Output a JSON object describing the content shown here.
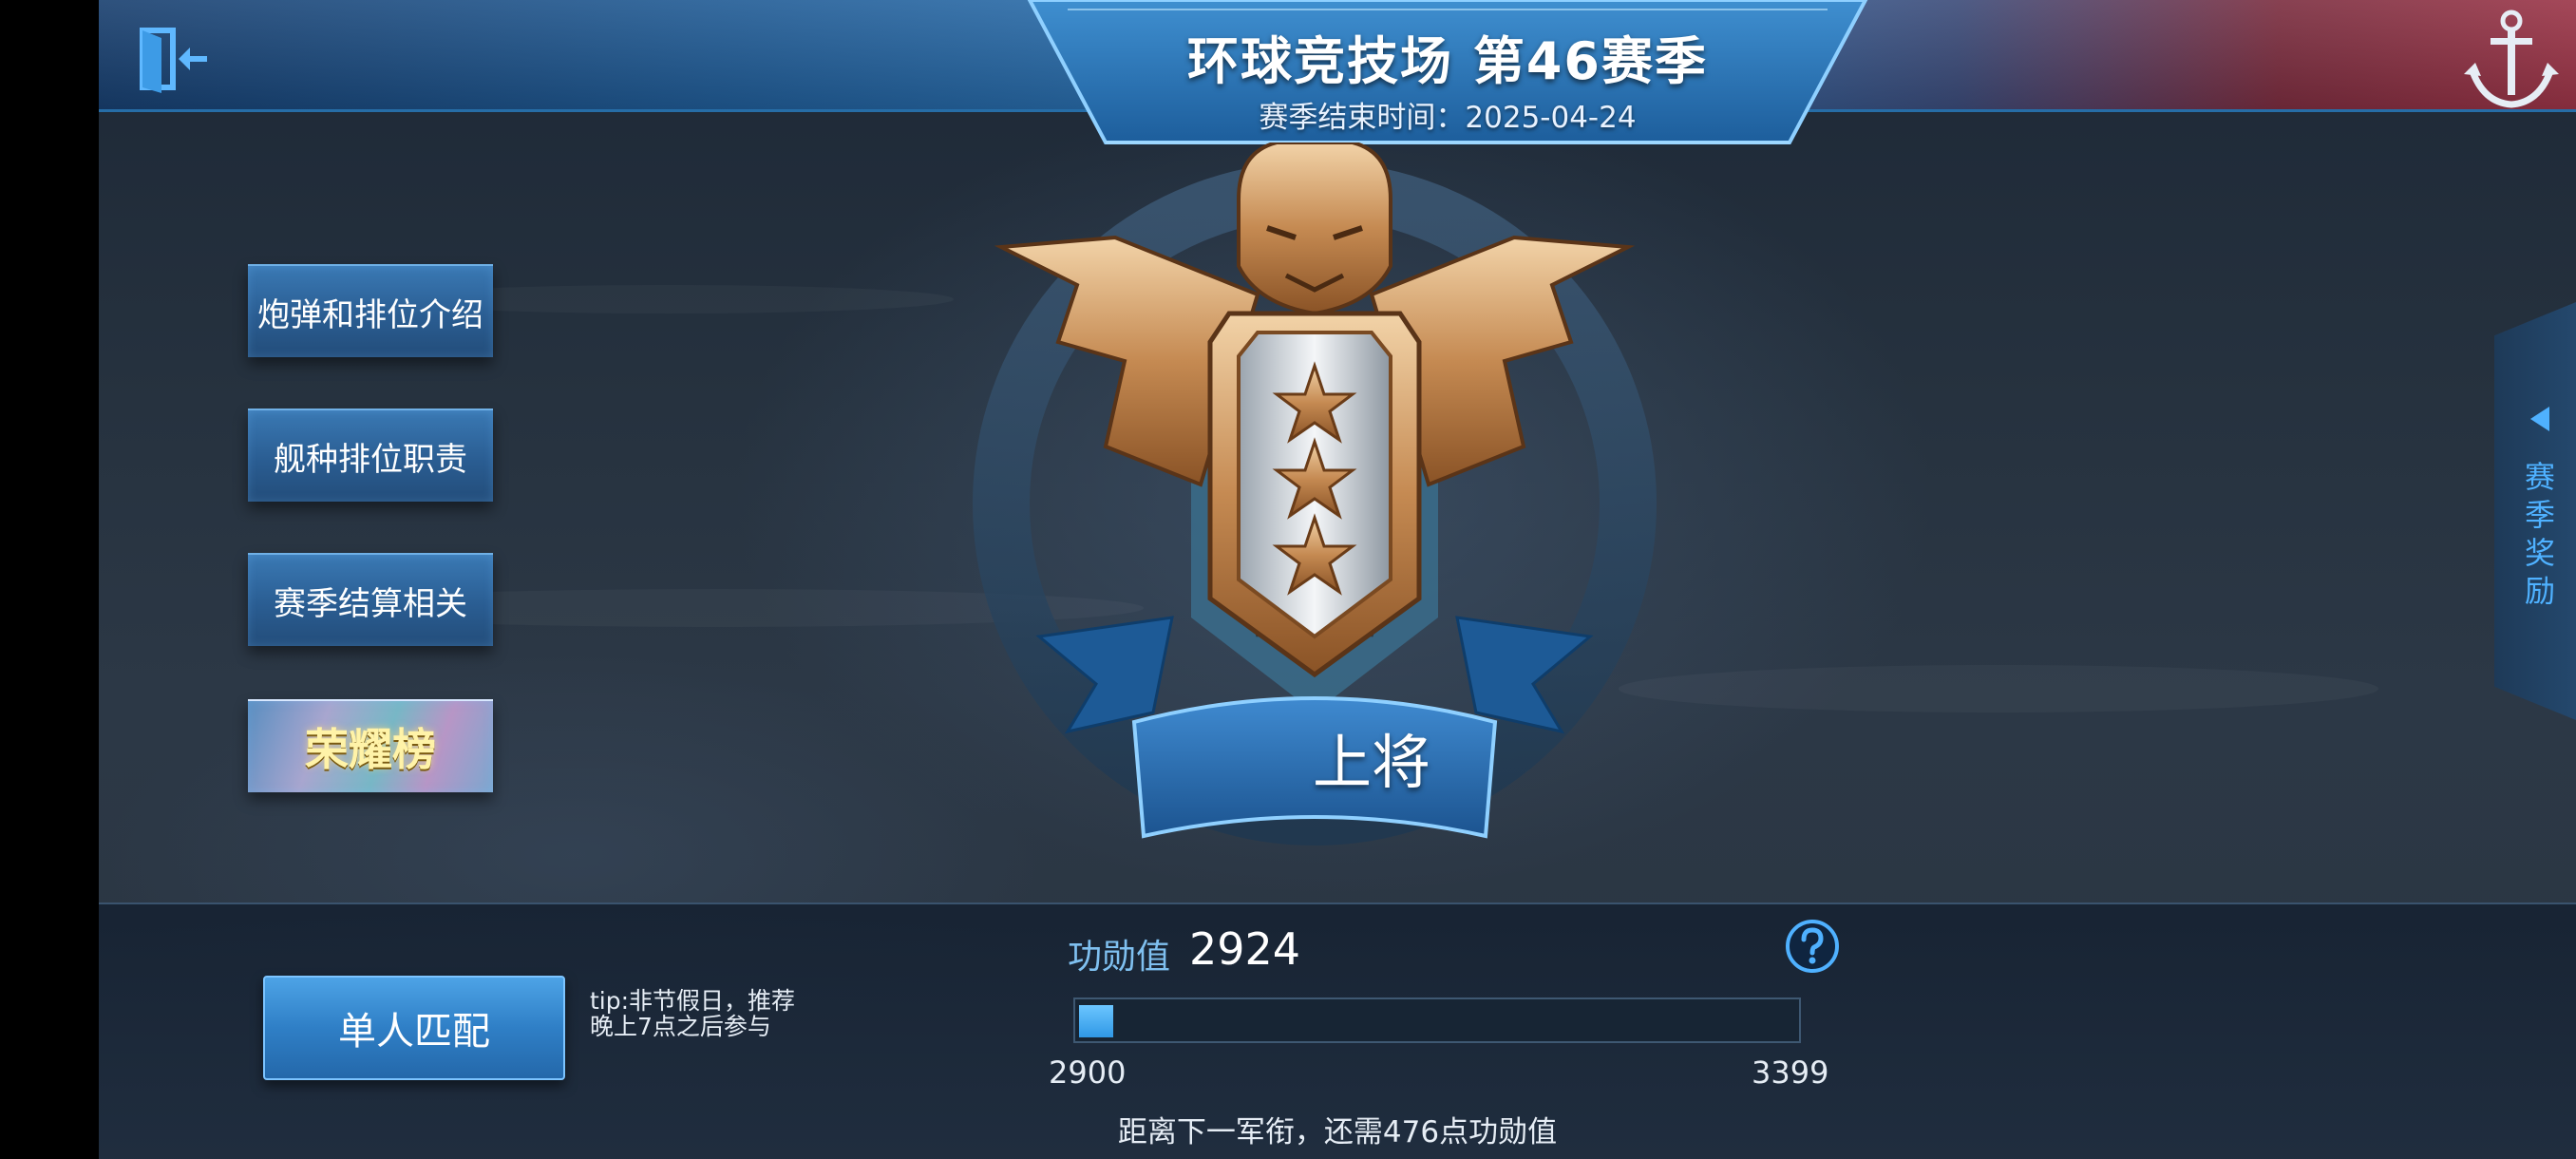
{
  "header": {
    "title": "环球竞技场  第46赛季",
    "season_end": "赛季结束时间：2025-04-24"
  },
  "menu": {
    "items": [
      {
        "label": "炮弹和排位介绍"
      },
      {
        "label": "舰种排位职责"
      },
      {
        "label": "赛季结算相关"
      },
      {
        "label": "荣耀榜"
      }
    ]
  },
  "rank": {
    "name": "上将",
    "stars": 3
  },
  "reward_tab": {
    "label": "赛季奖励"
  },
  "match": {
    "button_label": "单人匹配",
    "tip": "tip:非节假日，推荐晚上7点之后参与"
  },
  "merit": {
    "label": "功勋值",
    "value": "2924",
    "min": "2900",
    "max": "3399",
    "progress_fraction": 0.048,
    "next_rank_text": "距离下一军衔，还需476点功勋值"
  },
  "colors": {
    "accent_blue": "#2f98e6",
    "gold_text": "#fff3a8",
    "reward_text": "#4fb1ff"
  },
  "icons": {
    "exit": "exit-door-icon",
    "anchor": "anchor-icon",
    "help": "question-circle-icon",
    "reward_arrow": "triangle-left-icon"
  }
}
